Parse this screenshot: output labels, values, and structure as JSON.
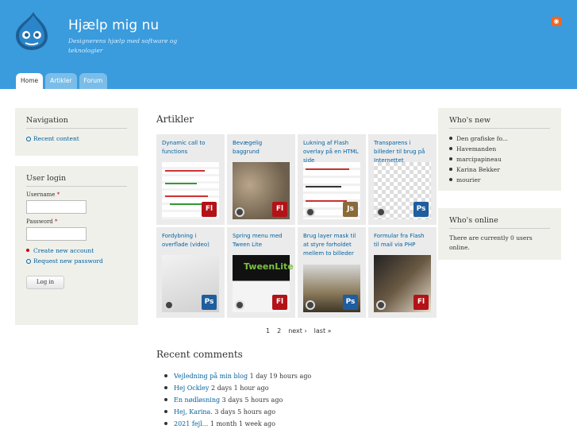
{
  "site": {
    "name": "Hjælp mig nu",
    "slogan": "Designerens hjælp med software og teknologier"
  },
  "tabs": [
    {
      "label": "Home"
    },
    {
      "label": "Artikler"
    },
    {
      "label": "Forum"
    }
  ],
  "navigation": {
    "title": "Navigation",
    "items": [
      {
        "label": "Recent content"
      }
    ]
  },
  "login": {
    "title": "User login",
    "username_label": "Username",
    "password_label": "Password",
    "required": "*",
    "links": [
      {
        "label": "Create new account"
      },
      {
        "label": "Request new password"
      }
    ],
    "button": "Log in"
  },
  "main": {
    "title": "Artikler"
  },
  "articles": [
    {
      "title": "Dynamic call to functions",
      "badge": "Fl"
    },
    {
      "title": "Bevægelig baggrund",
      "badge": "Fl"
    },
    {
      "title": "Lukning af Flash overlay på en HTML side",
      "badge": "Js"
    },
    {
      "title": "Transparens i billeder til brug på Internettet",
      "badge": "Ps"
    },
    {
      "title": "Fordybning i overflade (video)",
      "badge": "Ps"
    },
    {
      "title": "Spring menu med Tween Lite",
      "badge": "Fl"
    },
    {
      "title": "Brug layer mask til at styre forholdet mellem to billeder",
      "badge": "Ps"
    },
    {
      "title": "Formular fra Flash til mail via PHP",
      "badge": "Fl"
    }
  ],
  "pager": {
    "page1": "1",
    "page2": "2",
    "next": "next ›",
    "last": "last »"
  },
  "recent_comments": {
    "title": "Recent comments",
    "items": [
      {
        "link": "Vejledning på min blog",
        "ago": "1 day 19 hours ago"
      },
      {
        "link": "Hej Ockley",
        "ago": "2 days 1 hour ago"
      },
      {
        "link": "En nødløsning",
        "ago": "3 days 5 hours ago"
      },
      {
        "link": "Hej, Karina.",
        "ago": "3 days 5 hours ago"
      },
      {
        "link": "2021 fejl...",
        "ago": "1 month 1 week ago"
      }
    ]
  },
  "whos_new": {
    "title": "Who's new",
    "items": [
      "Den grafiske fo...",
      "Havemanden",
      "marcipapineau",
      "Karina Bekker",
      "mourier"
    ]
  },
  "whos_online": {
    "title": "Who's online",
    "text": "There are currently 0 users online."
  },
  "colors": {
    "header": "#3a9bdd",
    "link": "#0062a0",
    "block_bg": "#f0f0ea"
  }
}
